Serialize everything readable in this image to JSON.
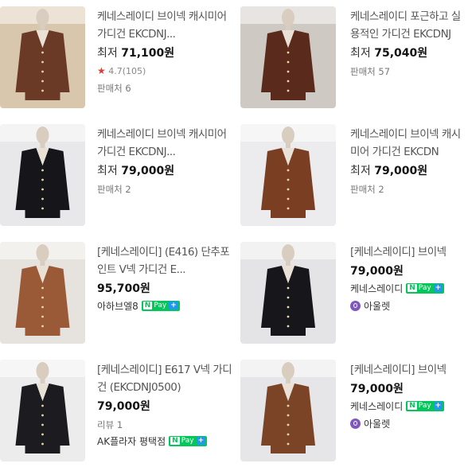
{
  "products": [
    {
      "title": "케네스레이디 브이넥 캐시미어 가디건 EKCDNJ...",
      "price_label": "최저",
      "price": "71,100원",
      "rating": "4.7(105)",
      "meta": "판매처 6",
      "color": "#6b3a26",
      "bg": "#d9c7ad"
    },
    {
      "title": "케네스레이디 포근하고 실용적인 가디건 EKCDNJ",
      "price_label": "최저",
      "price": "75,040원",
      "meta": "판매처 57",
      "color": "#5a2b1d",
      "bg": "#cfc9c4"
    },
    {
      "title": "케네스레이디 브이넥 캐시미어 가디건 EKCDNJ...",
      "price_label": "최저",
      "price": "79,000원",
      "meta": "판매처 2",
      "color": "#15151a",
      "bg": "#e8e8ea"
    },
    {
      "title": "케네스레이디 브이넥 캐시미어 가디건 EKCDN",
      "price_label": "최저",
      "price": "79,000원",
      "meta": "판매처 2",
      "color": "#7a3f22",
      "bg": "#ececee"
    },
    {
      "title": "[케네스레이디] (E416) 단추포인트 V넥 가디건 E...",
      "price": "95,700원",
      "seller": "아하브엘8"
    },
    {
      "title": "[케네스레이디] 브이넥",
      "price": "79,000원",
      "seller": "케네스레이디",
      "outlet": "아울렛"
    },
    {
      "title": "[케네스레이디] E617 V넥 가디건 (EKCDNJ0500)",
      "price": "79,000원",
      "meta": "리뷰 1",
      "seller": "AK플라자 평택점"
    },
    {
      "title": "[케네스레이디] 브이넥",
      "price": "79,000원",
      "seller": "케네스레이디",
      "outlet": "아울렛"
    }
  ],
  "thumbs": [
    {
      "color": "#6b3a26",
      "bg": "#d9c7ad"
    },
    {
      "color": "#5a2b1d",
      "bg": "#cfc9c4"
    },
    {
      "color": "#15151a",
      "bg": "#e8e8ea"
    },
    {
      "color": "#7a3f22",
      "bg": "#ececee"
    },
    {
      "color": "#9a5a38",
      "bg": "#e6e2dd"
    },
    {
      "color": "#16161b",
      "bg": "#e4e4e6"
    },
    {
      "color": "#1b1b20",
      "bg": "#ececec"
    },
    {
      "color": "#7b4426",
      "bg": "#e6e6e8"
    }
  ],
  "npay": {
    "n": "N",
    "pay": "Pay",
    "plus": "+"
  }
}
